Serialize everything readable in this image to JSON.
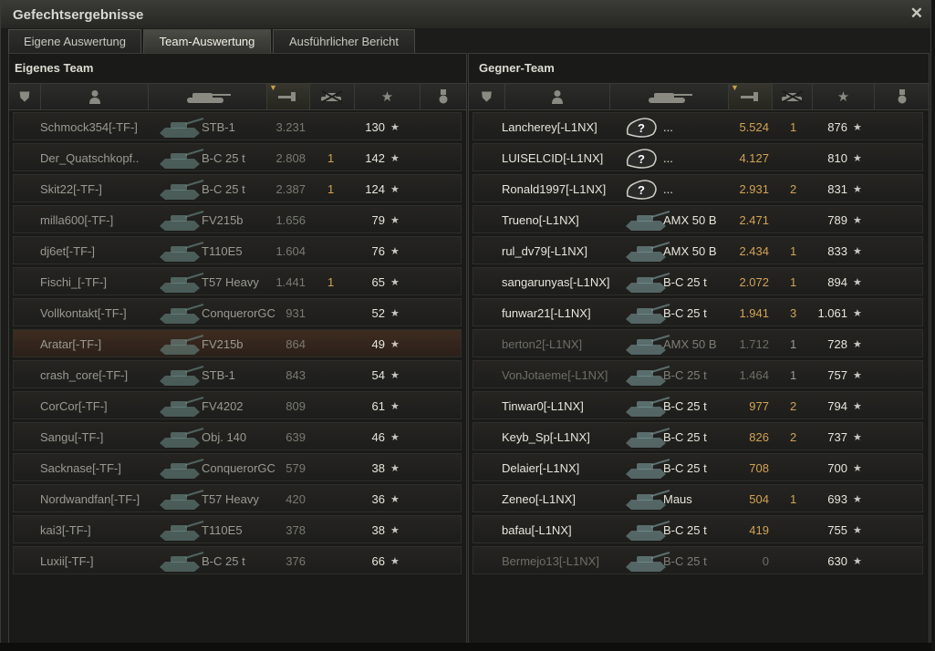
{
  "window": {
    "title": "Gefechtsergebnisse",
    "close_icon": "close-icon"
  },
  "tabs": [
    {
      "label": "Eigene Auswertung",
      "active": false
    },
    {
      "label": "Team-Auswertung",
      "active": true
    },
    {
      "label": "Ausführlicher Bericht",
      "active": false
    }
  ],
  "own_team": {
    "title": "Eigenes Team",
    "header_icons": [
      "squad-icon",
      "player-icon",
      "tank-icon",
      "damage-icon",
      "kills-icon",
      "xp-star-icon",
      "medal-icon"
    ],
    "rows": [
      {
        "player": "Schmock354[-TF-]",
        "tank": "STB-1",
        "damage": "3.231",
        "kills": "",
        "xp": "130",
        "highlight": false
      },
      {
        "player": "Der_Quatschkopf..",
        "tank": "B-C 25 t",
        "damage": "2.808",
        "kills": "1",
        "xp": "142",
        "highlight": false
      },
      {
        "player": "Skit22[-TF-]",
        "tank": "B-C 25 t",
        "damage": "2.387",
        "kills": "1",
        "xp": "124",
        "highlight": false
      },
      {
        "player": "milla600[-TF-]",
        "tank": "FV215b",
        "damage": "1.656",
        "kills": "",
        "xp": "79",
        "highlight": false
      },
      {
        "player": "dj6et[-TF-]",
        "tank": "T110E5",
        "damage": "1.604",
        "kills": "",
        "xp": "76",
        "highlight": false
      },
      {
        "player": "Fischi_[-TF-]",
        "tank": "T57 Heavy",
        "damage": "1.441",
        "kills": "1",
        "xp": "65",
        "highlight": false
      },
      {
        "player": "Vollkontakt[-TF-]",
        "tank": "ConquerorGC",
        "damage": "931",
        "kills": "",
        "xp": "52",
        "highlight": false
      },
      {
        "player": "Aratar[-TF-]",
        "tank": "FV215b",
        "damage": "864",
        "kills": "",
        "xp": "49",
        "highlight": true
      },
      {
        "player": "crash_core[-TF-]",
        "tank": "STB-1",
        "damage": "843",
        "kills": "",
        "xp": "54",
        "highlight": false
      },
      {
        "player": "CorCor[-TF-]",
        "tank": "FV4202",
        "damage": "809",
        "kills": "",
        "xp": "61",
        "highlight": false
      },
      {
        "player": "Sangu[-TF-]",
        "tank": "Obj. 140",
        "damage": "639",
        "kills": "",
        "xp": "46",
        "highlight": false
      },
      {
        "player": "Sacknase[-TF-]",
        "tank": "ConquerorGC",
        "damage": "579",
        "kills": "",
        "xp": "38",
        "highlight": false
      },
      {
        "player": "Nordwandfan[-TF-]",
        "tank": "T57 Heavy",
        "damage": "420",
        "kills": "",
        "xp": "36",
        "highlight": false
      },
      {
        "player": "kai3[-TF-]",
        "tank": "T110E5",
        "damage": "378",
        "kills": "",
        "xp": "38",
        "highlight": false
      },
      {
        "player": "Luxii[-TF-]",
        "tank": "B-C 25 t",
        "damage": "376",
        "kills": "",
        "xp": "66",
        "highlight": false
      }
    ]
  },
  "enemy_team": {
    "title": "Gegner-Team",
    "header_icons": [
      "squad-icon",
      "player-icon",
      "tank-icon",
      "damage-icon",
      "kills-icon",
      "xp-star-icon",
      "medal-icon"
    ],
    "rows": [
      {
        "player": "Lancherey[-L1NX]",
        "tank": "...",
        "unknown": true,
        "damage": "5.524",
        "kills": "1",
        "xp": "876",
        "dim": false
      },
      {
        "player": "LUISELCID[-L1NX]",
        "tank": "...",
        "unknown": true,
        "damage": "4.127",
        "kills": "",
        "xp": "810",
        "dim": false
      },
      {
        "player": "Ronald1997[-L1NX]",
        "tank": "...",
        "unknown": true,
        "damage": "2.931",
        "kills": "2",
        "xp": "831",
        "dim": false
      },
      {
        "player": "Trueno[-L1NX]",
        "tank": "AMX 50 B",
        "unknown": false,
        "damage": "2.471",
        "kills": "",
        "xp": "789",
        "dim": false
      },
      {
        "player": "rul_dv79[-L1NX]",
        "tank": "AMX 50 B",
        "unknown": false,
        "damage": "2.434",
        "kills": "1",
        "xp": "833",
        "dim": false
      },
      {
        "player": "sangarunyas[-L1NX]",
        "tank": "B-C 25 t",
        "unknown": false,
        "damage": "2.072",
        "kills": "1",
        "xp": "894",
        "dim": false
      },
      {
        "player": "funwar21[-L1NX]",
        "tank": "B-C 25 t",
        "unknown": false,
        "damage": "1.941",
        "kills": "3",
        "xp": "1.061",
        "dim": false
      },
      {
        "player": "berton2[-L1NX]",
        "tank": "AMX 50 B",
        "unknown": false,
        "damage": "1.712",
        "kills": "1",
        "xp": "728",
        "dim": true
      },
      {
        "player": "VonJotaeme[-L1NX]",
        "tank": "B-C 25 t",
        "unknown": false,
        "damage": "1.464",
        "kills": "1",
        "xp": "757",
        "dim": true
      },
      {
        "player": "Tinwar0[-L1NX]",
        "tank": "B-C 25 t",
        "unknown": false,
        "damage": "977",
        "kills": "2",
        "xp": "794",
        "dim": false
      },
      {
        "player": "Keyb_Sp[-L1NX]",
        "tank": "B-C 25 t",
        "unknown": false,
        "damage": "826",
        "kills": "2",
        "xp": "737",
        "dim": false
      },
      {
        "player": "Delaier[-L1NX]",
        "tank": "B-C 25 t",
        "unknown": false,
        "damage": "708",
        "kills": "",
        "xp": "700",
        "dim": false
      },
      {
        "player": "Zeneo[-L1NX]",
        "tank": "Maus",
        "unknown": false,
        "damage": "504",
        "kills": "1",
        "xp": "693",
        "dim": false
      },
      {
        "player": "bafau[-L1NX]",
        "tank": "B-C 25 t",
        "unknown": false,
        "damage": "419",
        "kills": "",
        "xp": "755",
        "dim": false
      },
      {
        "player": "Bermejo13[-L1NX]",
        "tank": "B-C 25 t",
        "unknown": false,
        "damage": "0",
        "kills": "",
        "xp": "630",
        "dim": true
      }
    ]
  },
  "colors": {
    "enemy_damage": "#d2a254",
    "own_damage": "#7a7a72",
    "dead_text": "#6e6e66",
    "alive_text": "#e6e6dc",
    "own_player": "#9a9a92"
  }
}
